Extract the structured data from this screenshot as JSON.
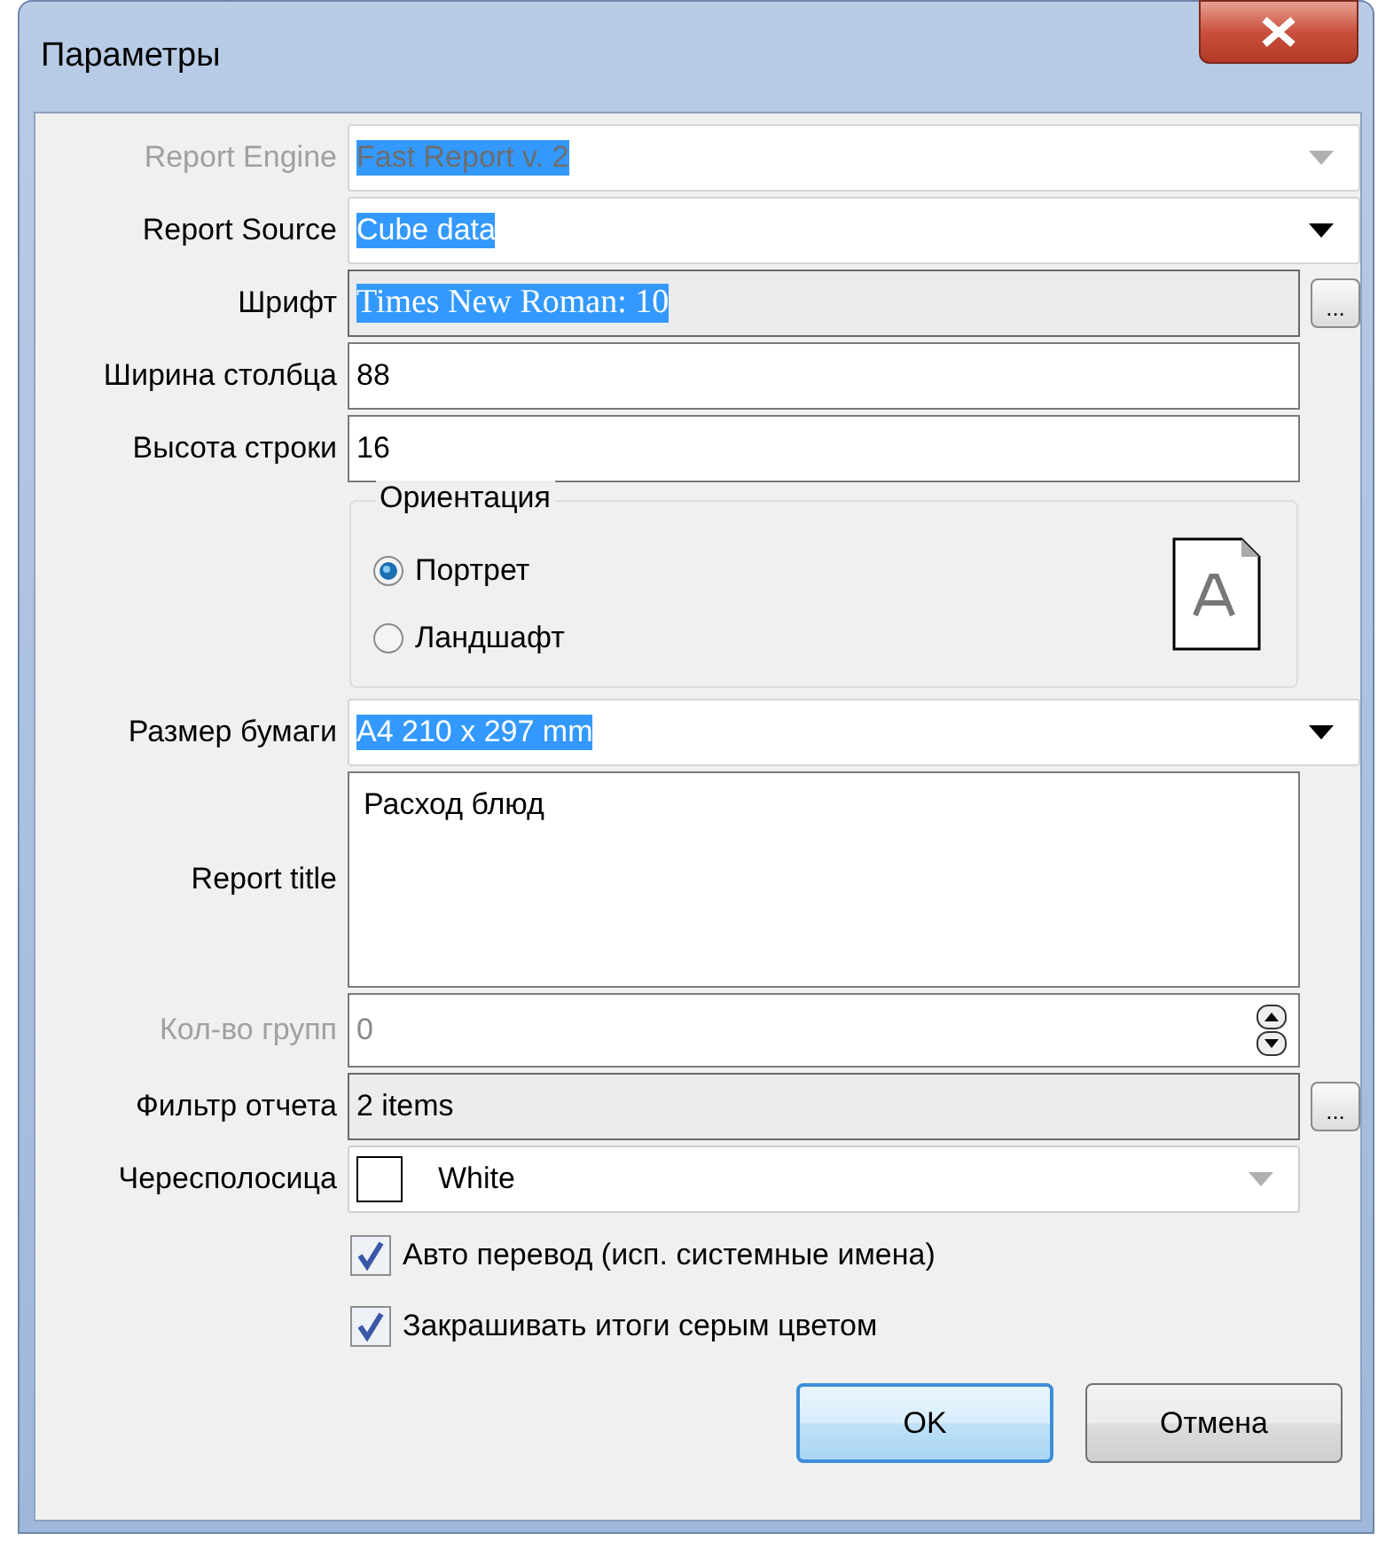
{
  "window": {
    "title": "Параметры"
  },
  "fields_top": [
    {
      "kind": "combo",
      "label": "Report Engine",
      "value": "Fast Report v. 2",
      "disabled": true,
      "highlighted": true
    },
    {
      "kind": "combo",
      "label": "Report Source",
      "value": "Cube data",
      "disabled": false,
      "highlighted": true
    },
    {
      "kind": "picker",
      "label": "Шрифт",
      "value": "Times New Roman: 10",
      "disabled": false,
      "highlighted": true,
      "button": "..."
    },
    {
      "kind": "text",
      "label": "Ширина столбца",
      "value": "88",
      "disabled": false,
      "highlighted": false
    },
    {
      "kind": "text",
      "label": "Высота строки",
      "value": "16",
      "disabled": false,
      "highlighted": false
    }
  ],
  "orientation": {
    "title": "Ориентация",
    "options": [
      {
        "label": "Портрет",
        "selected": true
      },
      {
        "label": "Ландшафт",
        "selected": false
      }
    ]
  },
  "fields_bottom": [
    {
      "kind": "combo",
      "label": "Размер бумаги",
      "value": "A4 210 x 297 mm",
      "disabled": false,
      "highlighted": true
    },
    {
      "kind": "memo",
      "label": "Report title",
      "value": "Расход блюд",
      "disabled": false,
      "highlighted": false
    },
    {
      "kind": "spin",
      "label": "Кол-во групп",
      "value": "0",
      "disabled": true,
      "highlighted": false
    },
    {
      "kind": "picker",
      "label": "Фильтр отчета",
      "value": "2 items",
      "disabled": false,
      "highlighted": false,
      "button": "..."
    },
    {
      "kind": "colorcombo",
      "label": "Чересполосица",
      "value": "White",
      "disabled": false,
      "highlighted": false,
      "color": "#ffffff"
    }
  ],
  "checkboxes": [
    {
      "label": "Авто перевод (исп. системные имена)",
      "checked": true
    },
    {
      "label": "Закрашивать итоги серым цветом",
      "checked": true
    }
  ],
  "buttons": [
    {
      "label": "OK",
      "default": true
    },
    {
      "label": "Отмена",
      "default": false
    }
  ]
}
